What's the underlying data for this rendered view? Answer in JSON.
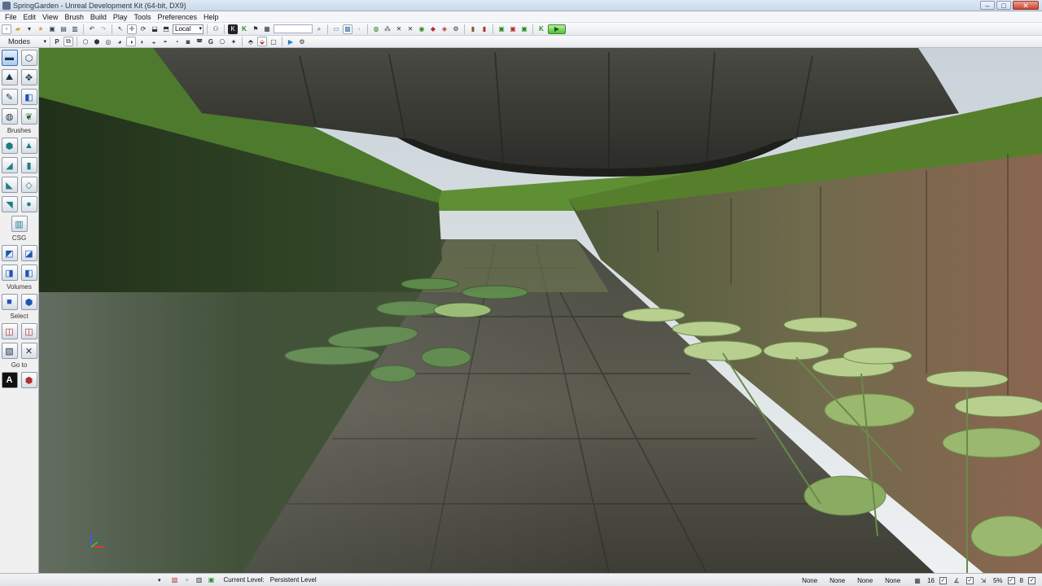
{
  "window": {
    "title": "SpringGarden - Unreal Development Kit (64-bit, DX9)",
    "minimize": "–",
    "maximize": "□",
    "close": "✕"
  },
  "menu": [
    "File",
    "Edit",
    "View",
    "Brush",
    "Build",
    "Play",
    "Tools",
    "Preferences",
    "Help"
  ],
  "toolbar": {
    "coordinate_system": "Local"
  },
  "modes_panel": {
    "header": "Modes",
    "sections": {
      "brushes": "Brushes",
      "csg": "CSG",
      "volumes": "Volumes",
      "select": "Select",
      "goto": "Go to"
    }
  },
  "statusbar": {
    "current_level_label": "Current Level:",
    "current_level_value": "Persistent Level",
    "snap_fields": [
      "None",
      "None",
      "None",
      "None"
    ],
    "grid_size": "16",
    "rotation_snap": "5%",
    "drag_grid": "8"
  },
  "colors": {
    "accent_green": "#2fb52f",
    "selected_blue": "#3b6fb0",
    "viewport_grass": "#4c7a2a",
    "viewport_stone": "#5b5a50"
  }
}
